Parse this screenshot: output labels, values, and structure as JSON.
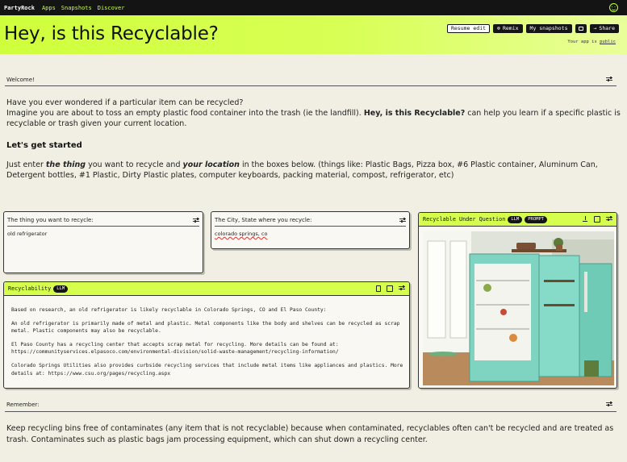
{
  "nav": {
    "brand": "PartyRock",
    "links": [
      "Apps",
      "Snapshots",
      "Discover"
    ]
  },
  "hero": {
    "title": "Hey, is this Recyclable?",
    "buttons": {
      "resume": "Resume edit",
      "remix": "Remix",
      "snapshots": "My snapshots",
      "share": "Share"
    },
    "public_prefix": "Your app is",
    "public_link": "public"
  },
  "welcome": {
    "label": "Welcome!",
    "p1": "Have you ever wondered if a particular item can be recycled?",
    "p2a": "Imagine you are about to toss an empty plastic food container into the trash (ie the landfill).",
    "p2b": "Hey, is this Recyclable?",
    "p2c": "can help you learn if a specific plastic is recyclable or trash given your current location.",
    "heading": "Let's get started",
    "p3a": "Just enter",
    "p3b": "the thing",
    "p3c": "you want to recycle and",
    "p3d": "your location",
    "p3e": "in the boxes below. (things like: Plastic Bags, Pizza box, #6 Plastic container, Aluminum Can, Detergent bottles, #1 Plastic, Dirty Plastic plates, computer keyboards, packing material, compost, refrigerator, etc)"
  },
  "inputs": {
    "thing": {
      "label": "The thing you want to recycle:",
      "value": "old refrigerator"
    },
    "city": {
      "label": "The City, State where you recycle:",
      "value": "colorado springs, co"
    }
  },
  "image_widget": {
    "title": "Recyclable Under Question",
    "badges": [
      "LLM",
      "PROMPT"
    ]
  },
  "recyclability": {
    "title": "Recyclability",
    "badge": "LLM",
    "paragraphs": [
      "Based on research, an old refrigerator is likely recyclable in Colorado Springs, CO and El Paso County:",
      "An old refrigerator is primarily made of metal and plastic. Metal components like the body and shelves can be recycled as scrap metal. Plastic components may also be recyclable.",
      "El Paso County has a recycling center that accepts scrap metal for recycling. More details can be found at: https://communityservices.elpasoco.com/environmental-division/solid-waste-management/recycling-information/",
      "Colorado Springs Utilities also provides curbside recycling services that include metal items like appliances and plastics. More details at: https://www.csu.org/pages/recycling.aspx"
    ]
  },
  "remember": {
    "label": "Remember:",
    "text": "Keep recycling bins free of contaminates (any item that is not recyclable) because when contaminated, recyclables often can't be recycled and are treated as trash. Contaminates such as plastic bags jam processing equipment, which can shut down a recycling center."
  }
}
